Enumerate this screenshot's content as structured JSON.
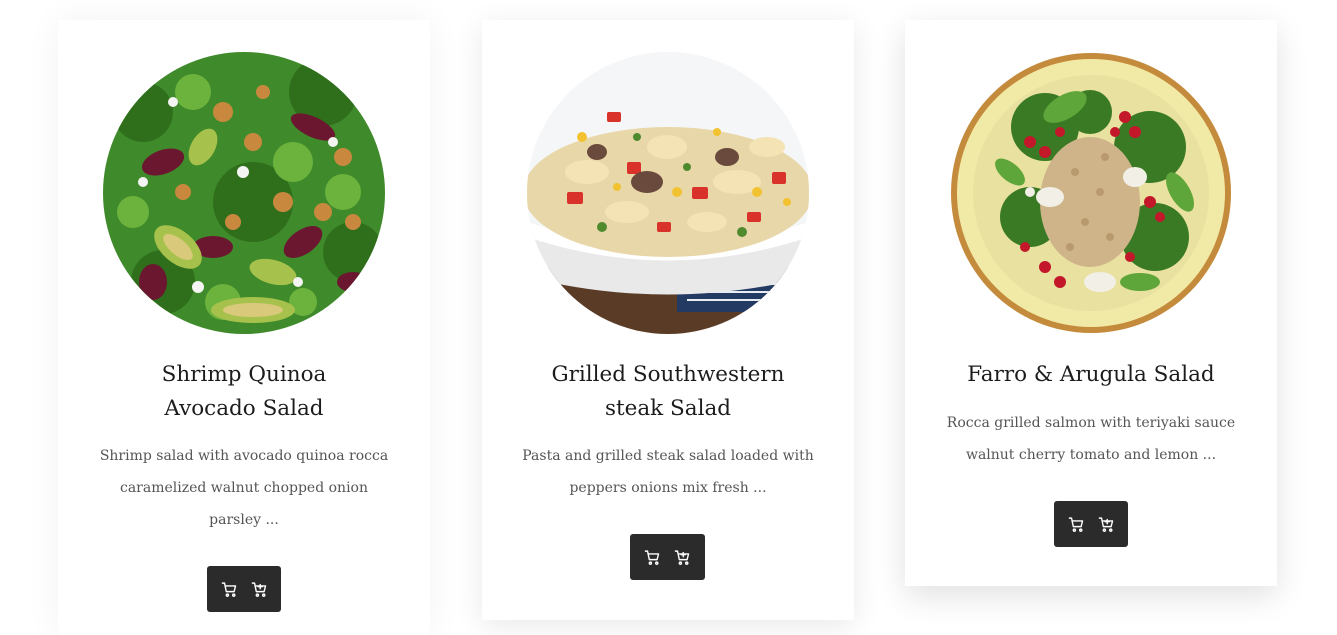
{
  "products": [
    {
      "title_lines": [
        "Shrimp Quinoa",
        "Avocado Salad"
      ],
      "description_lines": [
        "Shrimp salad with avocado quinoa rocca",
        "caramelized walnut chopped onion",
        "parsley ..."
      ],
      "image_icon": "salad-beet-walnut-avocado-image"
    },
    {
      "title_lines": [
        "Grilled Southwestern",
        "steak Salad"
      ],
      "description_lines": [
        "Pasta and grilled steak salad loaded with",
        "peppers onions mix fresh ..."
      ],
      "image_icon": "pasta-steak-salad-bowl-image"
    },
    {
      "title_lines": [
        "Farro & Arugula Salad"
      ],
      "description_lines": [
        "Rocca grilled salmon with teriyaki sauce",
        "walnut cherry tomato and lemon ..."
      ],
      "image_icon": "farro-pomegranate-salad-bowl-image"
    }
  ],
  "actions": {
    "cart_icon": "shopping-cart-icon",
    "add_to_cart_icon": "add-to-cart-icon"
  },
  "colors": {
    "button_bg": "#2b2b2b",
    "title_text": "#1c1c1c",
    "description_text": "#555555",
    "page_bg": "#ffffff"
  }
}
